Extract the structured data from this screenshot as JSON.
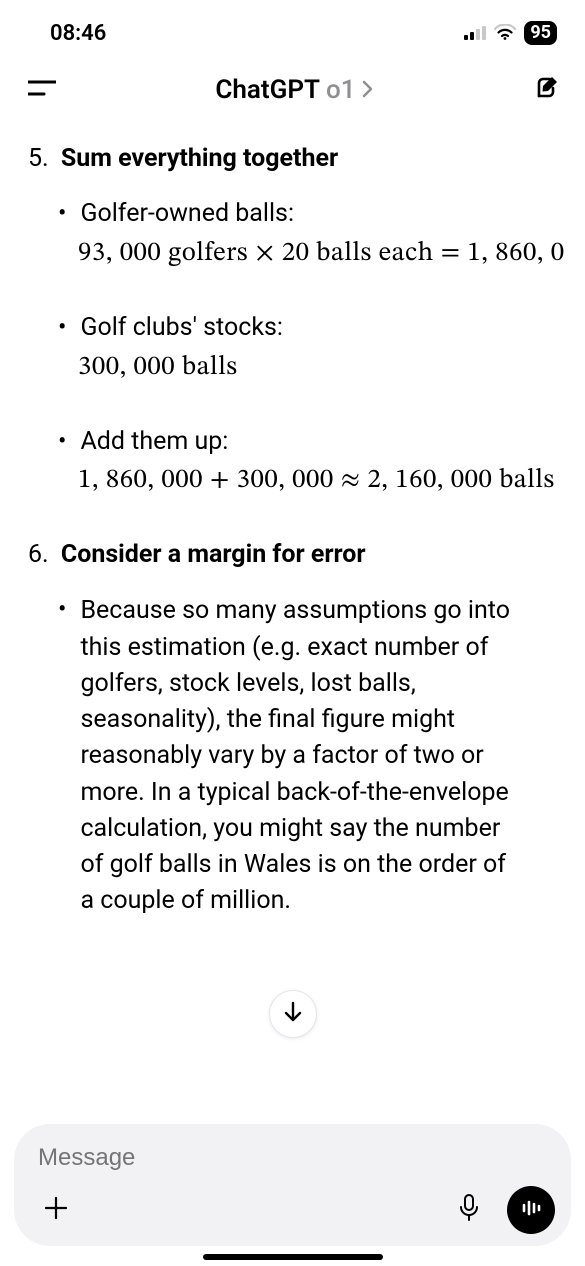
{
  "status": {
    "time": "08:46",
    "battery": "95"
  },
  "nav": {
    "title": "ChatGPT",
    "model": "o1"
  },
  "sections": [
    {
      "num": "5.",
      "title": "Sum everything together",
      "items": [
        {
          "label": "Golfer-owned balls:",
          "math": "93, 000 golfers × 20 balls each = 1, 860, 0"
        },
        {
          "label": "Golf clubs' stocks:",
          "math": "300, 000 balls"
        },
        {
          "label": "Add them up:",
          "math": "1, 860, 000 + 300, 000 ≈ 2, 160, 000 balls"
        }
      ]
    },
    {
      "num": "6.",
      "title": "Consider a margin for error",
      "paragraph": "Because so many assumptions go into this estimation (e.g. exact number of golfers, stock levels, lost balls, seasonality), the final figure might reasonably vary by a factor of two or more. In a typical back-of-the-envelope calculation, you might say the number of golf balls in Wales is on the order of a couple of million."
    }
  ],
  "composer": {
    "placeholder": "Message"
  }
}
